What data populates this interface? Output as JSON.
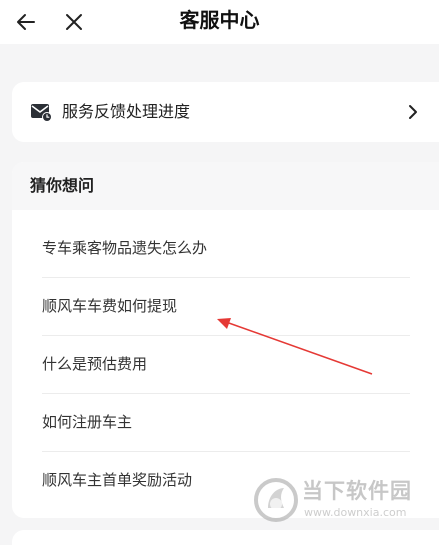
{
  "header": {
    "title": "客服中心",
    "back_icon": "arrow-left-icon",
    "close_icon": "close-icon"
  },
  "feedback": {
    "label": "服务反馈处理进度",
    "icon": "mail-clock-icon",
    "chevron_icon": "chevron-right-icon"
  },
  "guess": {
    "title": "猜你想问",
    "questions": [
      "专车乘客物品遗失怎么办",
      "顺风车车费如何提现",
      "什么是预估费用",
      "如何注册车主",
      "顺风车主首单奖励活动"
    ]
  },
  "annotation": {
    "color": "#e53935",
    "icon": "red-arrow-annotation"
  },
  "watermark": {
    "name": "当下软件园",
    "url": "www.downxia.com",
    "icon": "downxia-logo-icon"
  }
}
